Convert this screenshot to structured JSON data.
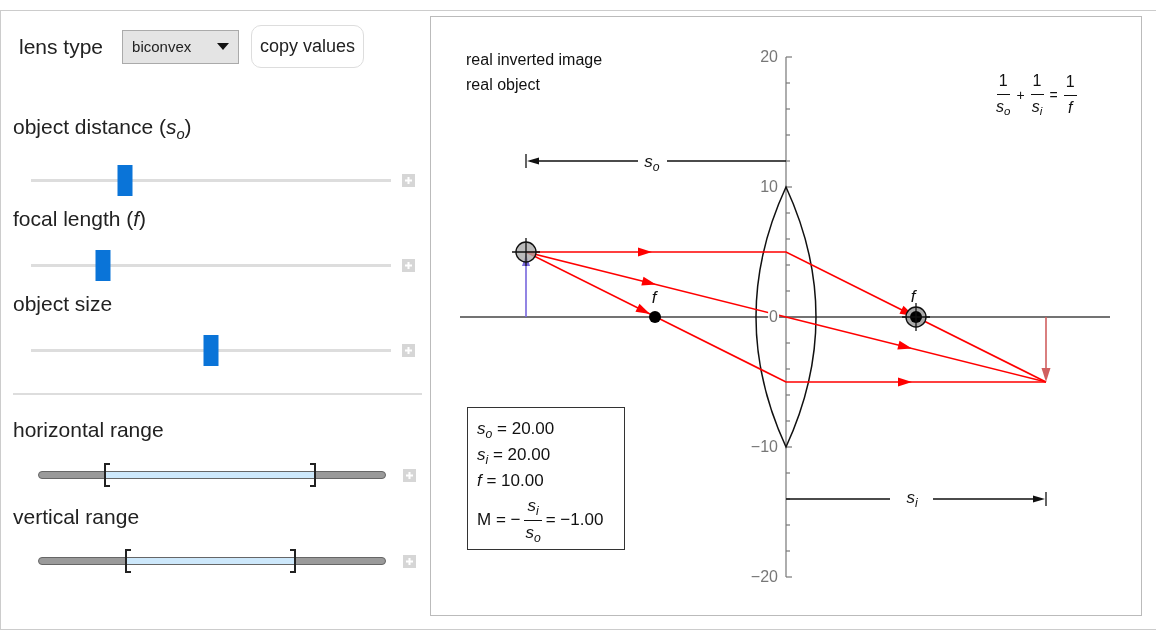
{
  "controls": {
    "lens_type": {
      "label": "lens type",
      "value": "biconvex"
    },
    "copy_button": "copy values"
  },
  "sliders": [
    {
      "label": "object distance (*s*$_{o}$)",
      "level": 0.26
    },
    {
      "label": "focal length (*f*)",
      "level": 0.2
    },
    {
      "label": "object size",
      "level": 0.5
    }
  ],
  "range_sliders": [
    {
      "label": "horizontal range",
      "start": {
        "level": 0.19
      },
      "end": {
        "level": 0.8
      }
    },
    {
      "label": "vertical range",
      "start": {
        "level": 0.25
      },
      "end": {
        "level": 0.74
      }
    }
  ],
  "plot": {
    "notes": [
      "real inverted image",
      "real object"
    ],
    "lens_equation": [
      {
        "kind": "fraction",
        "numerator": "1",
        "denominator": "s$_{o}$"
      },
      {
        "kind": "operator",
        "text": "+"
      },
      {
        "kind": "fraction",
        "numerator": "1",
        "denominator": "s$_{i}$"
      },
      {
        "kind": "operator",
        "text": "="
      },
      {
        "kind": "fraction",
        "numerator": "1",
        "denominator": "f"
      }
    ],
    "y_axis_labels": [
      "20",
      "10",
      "0",
      "−10",
      "−20"
    ],
    "focal_labels": [
      "f",
      "f"
    ],
    "object_distance_label": "s$_{o}$",
    "image_distance_label": "s$_{i}$",
    "readout": [
      {
        "kind": "line",
        "text": "*s*$_{o}$ = 20.00"
      },
      {
        "kind": "line",
        "text": "*s*$_{i}$ = 20.00"
      },
      {
        "kind": "line",
        "text": "*f* = 10.00"
      },
      {
        "kind": "fraction_line",
        "lead": "M = −",
        "numerator": "s$_{i}$",
        "denominator": "s$_{o}$",
        "tail": "= −1.00"
      }
    ]
  }
}
